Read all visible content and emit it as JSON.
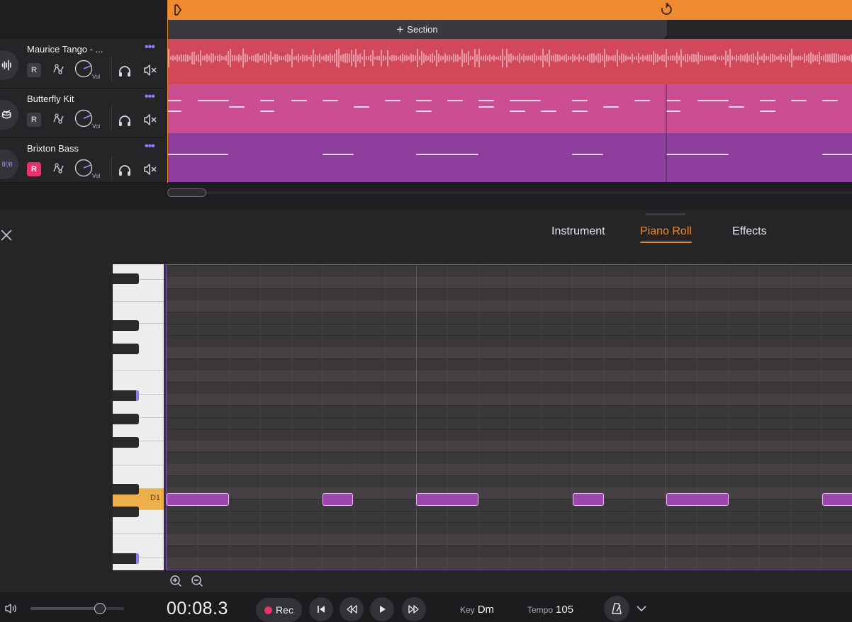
{
  "arrangement": {
    "section_button": "Section",
    "tracks": [
      {
        "name": "Maurice Tango - ...",
        "arm_label": "R",
        "armed": false,
        "knob_label": "Vol",
        "icon": "waveform-icon",
        "lane_color": "#d1485b"
      },
      {
        "name": "Butterfly Kit",
        "arm_label": "R",
        "armed": false,
        "knob_label": "Vol",
        "icon": "drum-icon",
        "lane_color": "#cb4d92"
      },
      {
        "name": "Brixton Bass",
        "arm_label": "R",
        "armed": true,
        "knob_label": "Vol",
        "icon_text": "808",
        "lane_color": "#8e3f9e"
      }
    ]
  },
  "editor": {
    "tabs": [
      {
        "label": "Instrument",
        "active": false
      },
      {
        "label": "Piano Roll",
        "active": true
      },
      {
        "label": "Effects",
        "active": false
      }
    ],
    "active_key_label": "D1"
  },
  "transport": {
    "time": "00:08.3",
    "rec_label": "Rec",
    "key_label": "Key",
    "key_value": "Dm",
    "tempo_label": "Tempo",
    "tempo_value": "105",
    "master_volume": 0.72
  },
  "colors": {
    "accent": "#ee8a2f",
    "record": "#e8336b",
    "track_menu": "#8b7cf6",
    "note_fill": "#9c45ad"
  }
}
